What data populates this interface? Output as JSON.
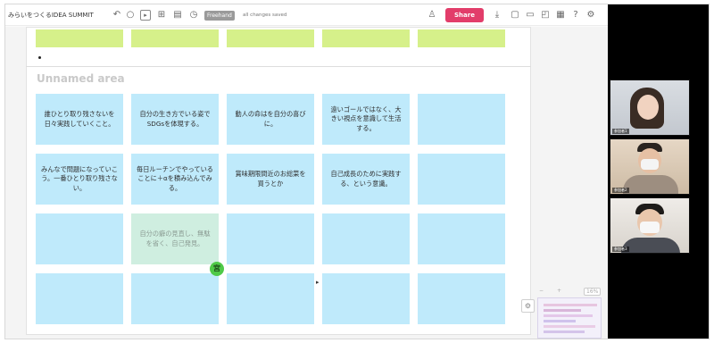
{
  "toolbar": {
    "board_title": "みらいをつくるIDEA SUMMIT",
    "freehand_badge": "Freehand",
    "saved_status": "all changes saved",
    "share_label": "Share"
  },
  "canvas": {
    "area_title": "Unnamed area",
    "top_row": [
      "",
      "",
      "",
      "",
      ""
    ],
    "rows": [
      [
        "誰ひとり取り残さないを日々実践していくこと。",
        "自分の生き方でいる姿でSDGsを体現する。",
        "動人の命はを自分の喜びに。",
        "遠いゴールではなく、大きい視点を意識して生活する。",
        ""
      ],
      [
        "みんなで問題になっていこう。一番ひとり取り残さない。",
        "毎日ルーチンでやっていることに＋αを積み込んでみる。",
        "賞味期限間近のお総菜を買うとか",
        "自己成長のために実践する、という意識。",
        ""
      ],
      [
        "",
        "自分の癖の見直し、無駄を省く、自己発見。",
        "",
        "",
        ""
      ],
      [
        "",
        "",
        "",
        "",
        ""
      ]
    ],
    "cursor_badge": "宮",
    "zoom": {
      "minus": "−",
      "plus": "+",
      "level": "16%"
    }
  },
  "video": {
    "participants": [
      {
        "name": "参加者1"
      },
      {
        "name": "参加者2"
      },
      {
        "name": "参加者3"
      }
    ]
  },
  "colors": {
    "sticky_green": "#d6f08a",
    "sticky_blue": "#bfeafb",
    "share": "#e23d6a",
    "cursor": "#4fc948"
  }
}
